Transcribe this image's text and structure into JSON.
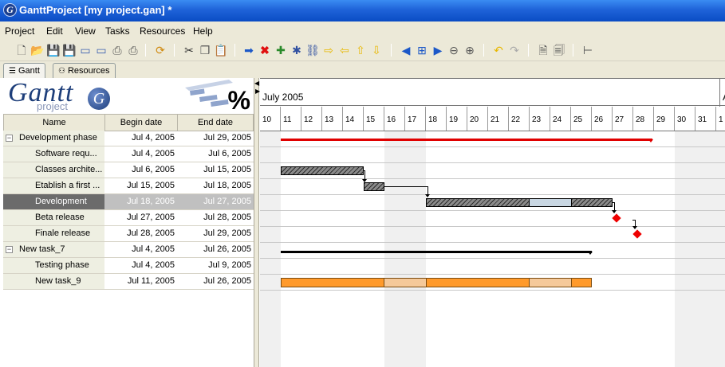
{
  "window": {
    "title": "GanttProject [my project.gan] *",
    "icon": "ganttproject-logo-icon"
  },
  "menu": [
    "Project",
    "Edit",
    "View",
    "Tasks",
    "Resources",
    "Help"
  ],
  "tabs": [
    {
      "label": "Gantt",
      "icon": "gantt-icon",
      "active": true
    },
    {
      "label": "Resources",
      "icon": "resources-icon",
      "active": false
    }
  ],
  "logo": {
    "title": "Gantt",
    "subtitle": "project",
    "badge": "G",
    "percent": "%"
  },
  "grid": {
    "headers": {
      "name": "Name",
      "begin": "Begin date",
      "end": "End date"
    },
    "rows": [
      {
        "name": "Development phase",
        "begin": "Jul 4, 2005",
        "end": "Jul 29, 2005",
        "expander": "−",
        "level": 0
      },
      {
        "name": "Software requ...",
        "begin": "Jul 4, 2005",
        "end": "Jul 6, 2005",
        "level": 1
      },
      {
        "name": "Classes archite...",
        "begin": "Jul 6, 2005",
        "end": "Jul 15, 2005",
        "level": 1
      },
      {
        "name": "Etablish a first ...",
        "begin": "Jul 15, 2005",
        "end": "Jul 18, 2005",
        "level": 1
      },
      {
        "name": "Development",
        "begin": "Jul 18, 2005",
        "end": "Jul 27, 2005",
        "level": 1,
        "selected": true
      },
      {
        "name": "Beta release",
        "begin": "Jul 27, 2005",
        "end": "Jul 28, 2005",
        "level": 1
      },
      {
        "name": "Finale release",
        "begin": "Jul 28, 2005",
        "end": "Jul 29, 2005",
        "level": 1
      },
      {
        "name": "New task_7",
        "begin": "Jul 4, 2005",
        "end": "Jul 26, 2005",
        "expander": "−",
        "level": 0
      },
      {
        "name": "Testing phase",
        "begin": "Jul 4, 2005",
        "end": "Jul 9, 2005",
        "level": 1
      },
      {
        "name": "New task_9",
        "begin": "Jul 11, 2005",
        "end": "Jul 26, 2005",
        "level": 1
      }
    ]
  },
  "timeline": {
    "months": [
      "July 2005",
      "A"
    ],
    "days": [
      "10",
      "11",
      "12",
      "13",
      "14",
      "15",
      "16",
      "17",
      "18",
      "19",
      "20",
      "21",
      "22",
      "23",
      "24",
      "25",
      "26",
      "27",
      "28",
      "29",
      "30",
      "31",
      "1"
    ]
  },
  "toolbar_icons": [
    "new-icon",
    "open-icon",
    "save-icon",
    "save-as-icon",
    "import-icon",
    "export-icon",
    "print-icon",
    "preview-icon",
    "refresh-icon",
    "cut-icon",
    "copy-icon",
    "paste-icon",
    "indent-icon",
    "delete-icon",
    "new-task-icon",
    "settings-icon",
    "link-icon",
    "arrow-left-icon",
    "arrow-up-icon",
    "arrow-down-icon",
    "scroll-left-icon",
    "center-icon",
    "scroll-right-icon",
    "zoom-out-icon",
    "zoom-in-icon",
    "undo-icon",
    "redo-icon",
    "report-icon",
    "resource-icon",
    "tree-icon"
  ],
  "colors": {
    "summary_red": "#e00000",
    "orange": "#ff9a2b",
    "selected_row": "#6b6b6b",
    "title_blue": "#0a4cc4"
  }
}
